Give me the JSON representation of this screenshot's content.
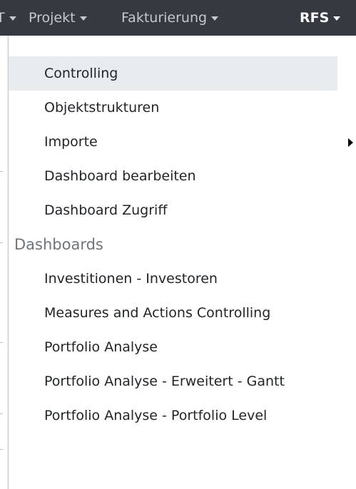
{
  "navbar": {
    "items": [
      {
        "label": "T"
      },
      {
        "label": "Projekt"
      },
      {
        "label": "Fakturierung"
      },
      {
        "label": "RFS"
      }
    ]
  },
  "dropdown": {
    "items": [
      {
        "label": "Controlling"
      },
      {
        "label": "Objektstrukturen"
      },
      {
        "label": "Importe"
      },
      {
        "label": "Dashboard bearbeiten"
      },
      {
        "label": "Dashboard Zugriff"
      }
    ],
    "section_header": "Dashboards",
    "dashboard_items": [
      {
        "label": "Investitionen - Investoren"
      },
      {
        "label": "Measures and Actions Controlling"
      },
      {
        "label": "Portfolio Analyse"
      },
      {
        "label": "Portfolio Analyse - Erweitert - Gantt"
      },
      {
        "label": "Portfolio Analyse - Portfolio Level"
      }
    ]
  }
}
